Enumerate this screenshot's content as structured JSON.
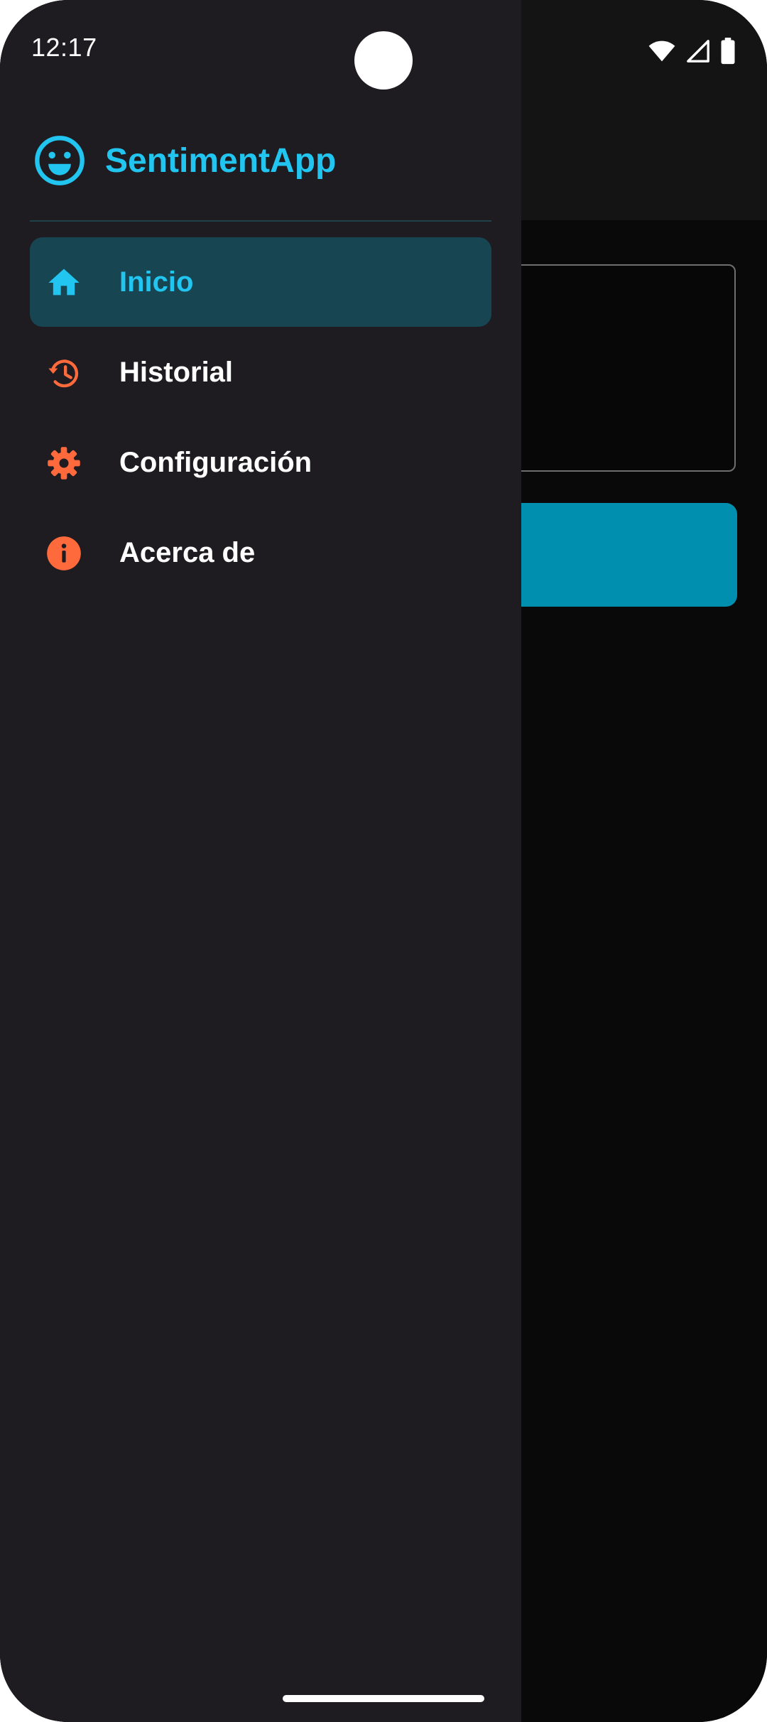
{
  "status_bar": {
    "time": "12:17",
    "icons": [
      "wifi-icon",
      "signal-icon",
      "battery-icon"
    ]
  },
  "drawer": {
    "app_name": "SentimentApp",
    "logo_icon": "smiley-face-icon",
    "items": [
      {
        "label": "Inicio",
        "icon": "home-icon",
        "active": true
      },
      {
        "label": "Historial",
        "icon": "history-icon",
        "active": false
      },
      {
        "label": "Configuración",
        "icon": "gear-icon",
        "active": false
      },
      {
        "label": "Acerca de",
        "icon": "info-icon",
        "active": false
      }
    ]
  },
  "colors": {
    "accent": "#21c5f0",
    "icon_orange": "#ff6a3d",
    "drawer_bg": "#1e1c21",
    "active_item_bg": "#174551",
    "primary_button": "#008fae"
  }
}
